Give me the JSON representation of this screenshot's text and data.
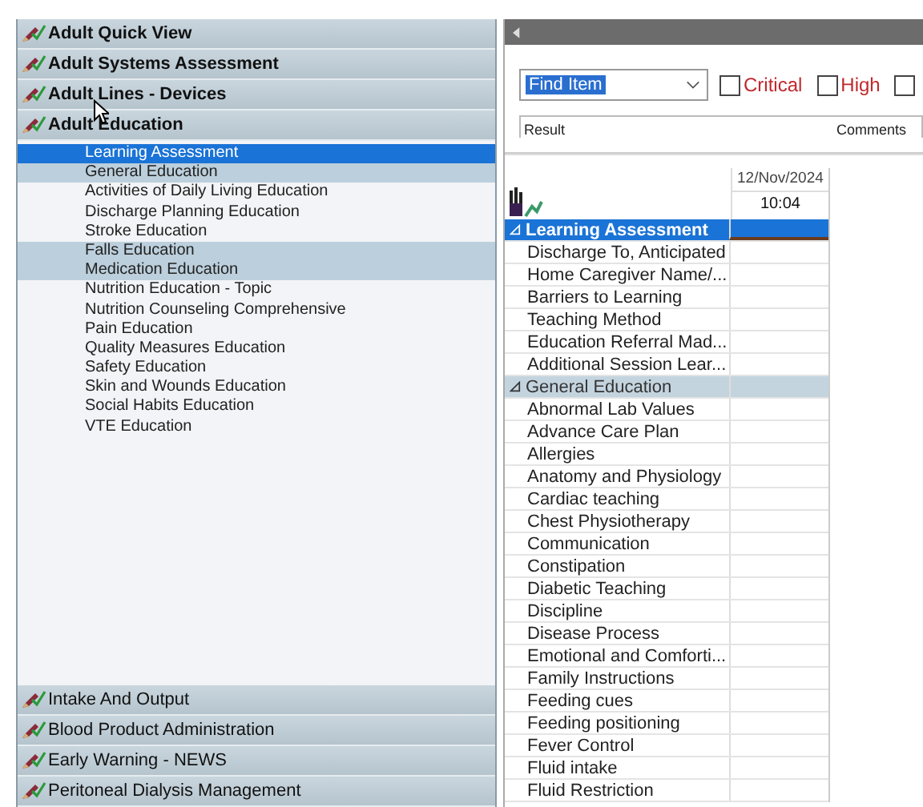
{
  "navigator": {
    "top_bands": [
      {
        "label": "Adult Quick View"
      },
      {
        "label": "Adult Systems Assessment"
      },
      {
        "label": "Adult Lines - Devices"
      },
      {
        "label": "Adult Education"
      }
    ],
    "items": [
      {
        "label": "Learning Assessment",
        "selected": true,
        "highlighted": false
      },
      {
        "label": "General Education",
        "selected": false,
        "highlighted": true
      },
      {
        "label": "Activities of Daily Living Education",
        "selected": false,
        "highlighted": false
      },
      {
        "label": "Discharge Planning Education",
        "selected": false,
        "highlighted": false
      },
      {
        "label": "Stroke Education",
        "selected": false,
        "highlighted": false
      },
      {
        "label": "Falls Education",
        "selected": false,
        "highlighted": true
      },
      {
        "label": "Medication Education",
        "selected": false,
        "highlighted": true
      },
      {
        "label": "Nutrition Education - Topic",
        "selected": false,
        "highlighted": false
      },
      {
        "label": "Nutrition Counseling Comprehensive",
        "selected": false,
        "highlighted": false
      },
      {
        "label": "Pain Education",
        "selected": false,
        "highlighted": false
      },
      {
        "label": "Quality Measures Education",
        "selected": false,
        "highlighted": false
      },
      {
        "label": "Safety Education",
        "selected": false,
        "highlighted": false
      },
      {
        "label": "Skin and Wounds Education",
        "selected": false,
        "highlighted": false
      },
      {
        "label": "Social Habits Education",
        "selected": false,
        "highlighted": false
      },
      {
        "label": "VTE Education",
        "selected": false,
        "highlighted": false
      }
    ],
    "bottom_bands": [
      {
        "label": "Intake And Output"
      },
      {
        "label": "Blood Product Administration"
      },
      {
        "label": "Early Warning - NEWS"
      },
      {
        "label": "Peritoneal Dialysis Management"
      }
    ]
  },
  "toolbar": {
    "find": {
      "value": "Find Item"
    },
    "filters": [
      {
        "label": "Critical",
        "checked": false
      },
      {
        "label": "High",
        "checked": false
      },
      {
        "checked": false
      }
    ],
    "columns": [
      "Result",
      "Comments"
    ]
  },
  "grid": {
    "date": "12/Nov/2024",
    "time": "10:04",
    "rows": [
      {
        "kind": "section",
        "label": "Learning Assessment",
        "selected": true,
        "expanded": true
      },
      {
        "kind": "item",
        "label": "Discharge To, Anticipated"
      },
      {
        "kind": "item",
        "label": "Home Caregiver Name/..."
      },
      {
        "kind": "item",
        "label": "Barriers to Learning"
      },
      {
        "kind": "item",
        "label": "Teaching Method"
      },
      {
        "kind": "item",
        "label": "Education Referral Mad..."
      },
      {
        "kind": "item",
        "label": "Additional Session Lear..."
      },
      {
        "kind": "section",
        "label": "General Education",
        "selected": false,
        "expanded": true
      },
      {
        "kind": "item",
        "label": "Abnormal Lab Values"
      },
      {
        "kind": "item",
        "label": "Advance Care Plan"
      },
      {
        "kind": "item",
        "label": "Allergies"
      },
      {
        "kind": "item",
        "label": "Anatomy and Physiology"
      },
      {
        "kind": "item",
        "label": "Cardiac teaching"
      },
      {
        "kind": "item",
        "label": "Chest Physiotherapy"
      },
      {
        "kind": "item",
        "label": "Communication"
      },
      {
        "kind": "item",
        "label": "Constipation"
      },
      {
        "kind": "item",
        "label": "Diabetic Teaching"
      },
      {
        "kind": "item",
        "label": "Discipline"
      },
      {
        "kind": "item",
        "label": "Disease Process"
      },
      {
        "kind": "item",
        "label": "Emotional and Comforti..."
      },
      {
        "kind": "item",
        "label": "Family Instructions"
      },
      {
        "kind": "item",
        "label": "Feeding cues"
      },
      {
        "kind": "item",
        "label": "Feeding positioning"
      },
      {
        "kind": "item",
        "label": "Fever Control"
      },
      {
        "kind": "item",
        "label": "Fluid intake"
      },
      {
        "kind": "item",
        "label": "Fluid Restriction"
      }
    ]
  }
}
